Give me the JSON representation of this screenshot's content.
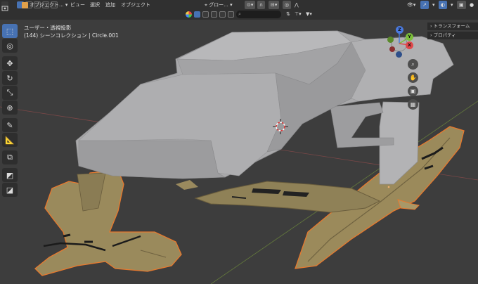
{
  "header": {
    "mode_label": "オブジェクト...",
    "menus": [
      "ビュー",
      "選択",
      "追加",
      "オブジェクト"
    ],
    "orientation_label": "グロー...",
    "search_placeholder": ""
  },
  "viewport": {
    "view_name": "ユーザー・透視投影",
    "collection_info": "(144) シーンコレクション | Circle.001"
  },
  "sidebar": {
    "tabs": [
      "トランスフォーム",
      "プロパティ"
    ]
  },
  "gizmo": {
    "axes": [
      "Z",
      "Y",
      "X"
    ],
    "nav_icons": [
      "zoom-icon",
      "hand-icon",
      "camera-icon",
      "grid-icon"
    ]
  },
  "toolbar": {
    "tools": [
      "select-box-icon",
      "cursor-icon",
      "move-icon",
      "rotate-icon",
      "scale-icon",
      "transform-icon",
      "annotate-icon",
      "measure-icon",
      "add-cube-icon",
      "extrude-icon",
      "shrink-icon"
    ]
  },
  "colors": {
    "header_bg": "#303030",
    "viewport_bg": "#3d3d3d",
    "accent": "#4772b3",
    "selection_outline": "#e8792e",
    "body_grey": "#a9a9ab",
    "gold_parts": "#9a8a5e"
  }
}
